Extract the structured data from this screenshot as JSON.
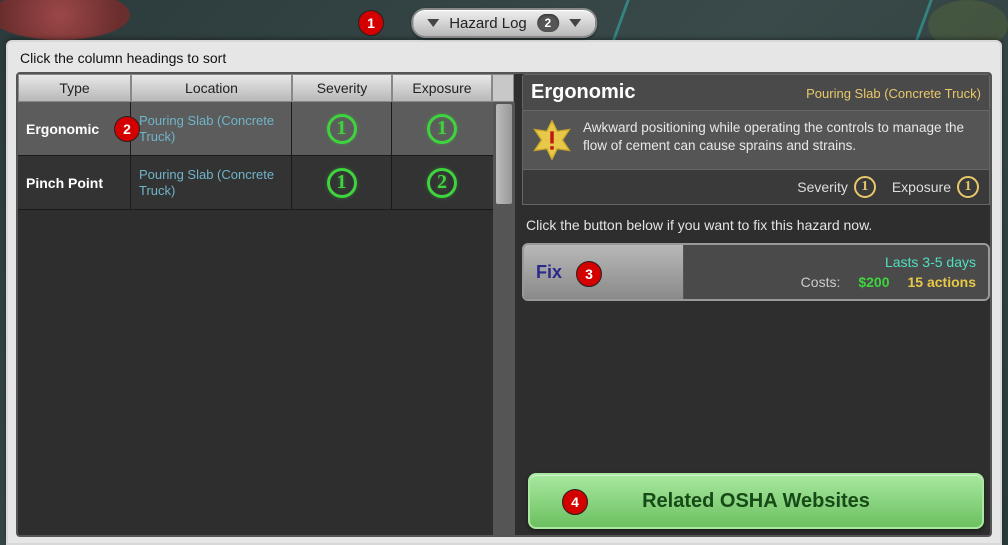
{
  "topbar": {
    "label": "Hazard Log",
    "count": "2"
  },
  "markers": {
    "m1": "1",
    "m2": "2",
    "m3": "3",
    "m4": "4"
  },
  "hint": "Click the column headings to sort",
  "columns": {
    "type": "Type",
    "location": "Location",
    "severity": "Severity",
    "exposure": "Exposure"
  },
  "rows": [
    {
      "type": "Ergonomic",
      "location": "Pouring Slab (Concrete Truck)",
      "severity": "1",
      "exposure": "1",
      "selected": true
    },
    {
      "type": "Pinch Point",
      "location": "Pouring Slab (Concrete Truck)",
      "severity": "1",
      "exposure": "2",
      "selected": false
    }
  ],
  "detail": {
    "title": "Ergonomic",
    "subtitle": "Pouring Slab (Concrete Truck)",
    "description": "Awkward positioning while operating the controls to manage the flow of cement can cause sprains and strains.",
    "severity_label": "Severity",
    "severity_val": "1",
    "exposure_label": "Exposure",
    "exposure_val": "1"
  },
  "fix": {
    "hint": "Click the button below if you want to fix this hazard now.",
    "label": "Fix",
    "lasts": "Lasts 3-5 days",
    "costs_label": "Costs:",
    "cost_money": "$200",
    "cost_actions": "15 actions"
  },
  "osha": {
    "label": "Related OSHA Websites"
  }
}
